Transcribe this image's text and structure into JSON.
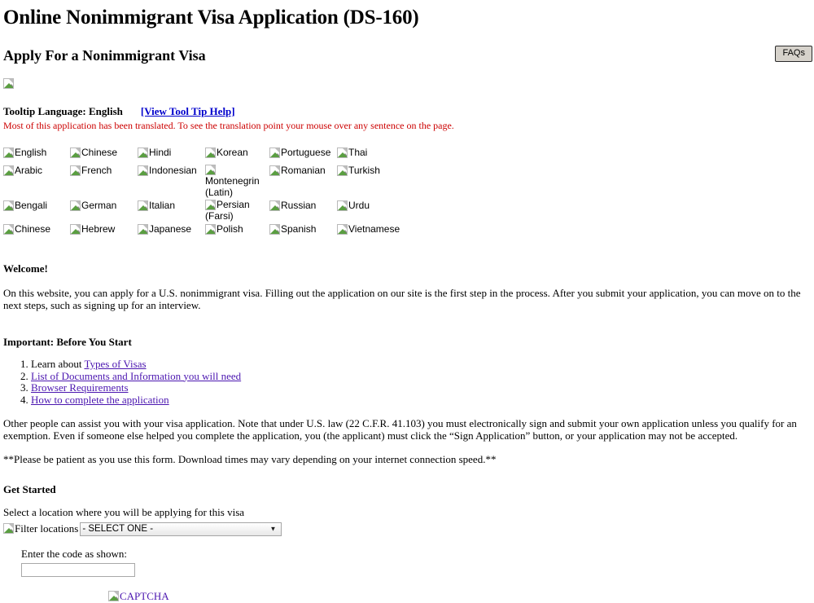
{
  "header": {
    "title": "Online Nonimmigrant Visa Application (DS-160)",
    "section_title": "Apply For a Nonimmigrant Visa",
    "faqs_label": "FAQs",
    "logo_icon": "broken-image-icon"
  },
  "tooltip": {
    "label": "Tooltip Language: English",
    "help_link": "[View Tool Tip Help]",
    "translate_note": "Most of this application has been translated. To see the translation point your mouse over any sentence on the page."
  },
  "languages": {
    "rows": [
      [
        "English",
        "Chinese",
        "Hindi",
        "Korean",
        "Portuguese",
        "Thai"
      ],
      [
        "Arabic",
        "French",
        "Indonesian",
        "Montenegrin (Latin)",
        "Romanian",
        "Turkish"
      ],
      [
        "Bengali",
        "German",
        "Italian",
        "Persian (Farsi)",
        "Russian",
        "Urdu"
      ],
      [
        "Chinese",
        "Hebrew",
        "Japanese",
        "Polish",
        "Spanish",
        "Vietnamese"
      ]
    ]
  },
  "welcome": {
    "heading": "Welcome!",
    "paragraph": "On this website, you can apply for a U.S. nonimmigrant visa. Filling out the application on our site is the first step in the process. After you submit your application, you can move on to the next steps, such as signing up for an interview."
  },
  "important": {
    "heading": "Important: Before You Start",
    "item1_prefix": "Learn about ",
    "item1_link": "Types of Visas",
    "item2_link": "List of Documents and Information you will need",
    "item3_link": "Browser Requirements",
    "item4_link": "How to complete the application",
    "assist_paragraph": "Other people can assist you with your visa application. Note that under U.S. law (22 C.F.R. 41.103) you must electronically sign and submit your own application unless you qualify for an exemption. Even if someone else helped you complete the application, you (the applicant) must click the “Sign Application” button, or your application may not be accepted.",
    "patience_paragraph": "**Please be patient as you use this form. Download times may vary depending on your internet connection speed.**"
  },
  "get_started": {
    "heading": "Get Started",
    "select_prompt": "Select a location where you will be applying for this visa",
    "filter_alt": "Filter locations",
    "location_selected": "- SELECT ONE -",
    "caret_icon": "chevron-down-icon",
    "captcha_label": "Enter the code as shown:",
    "code_value": "",
    "code_placeholder": "",
    "captcha_alt": "CAPTCHA"
  },
  "colors": {
    "link": "#4b16b0",
    "tooltip_link": "#0000cc",
    "notice_red": "#cc0000",
    "button_face": "#d6d2cb"
  }
}
